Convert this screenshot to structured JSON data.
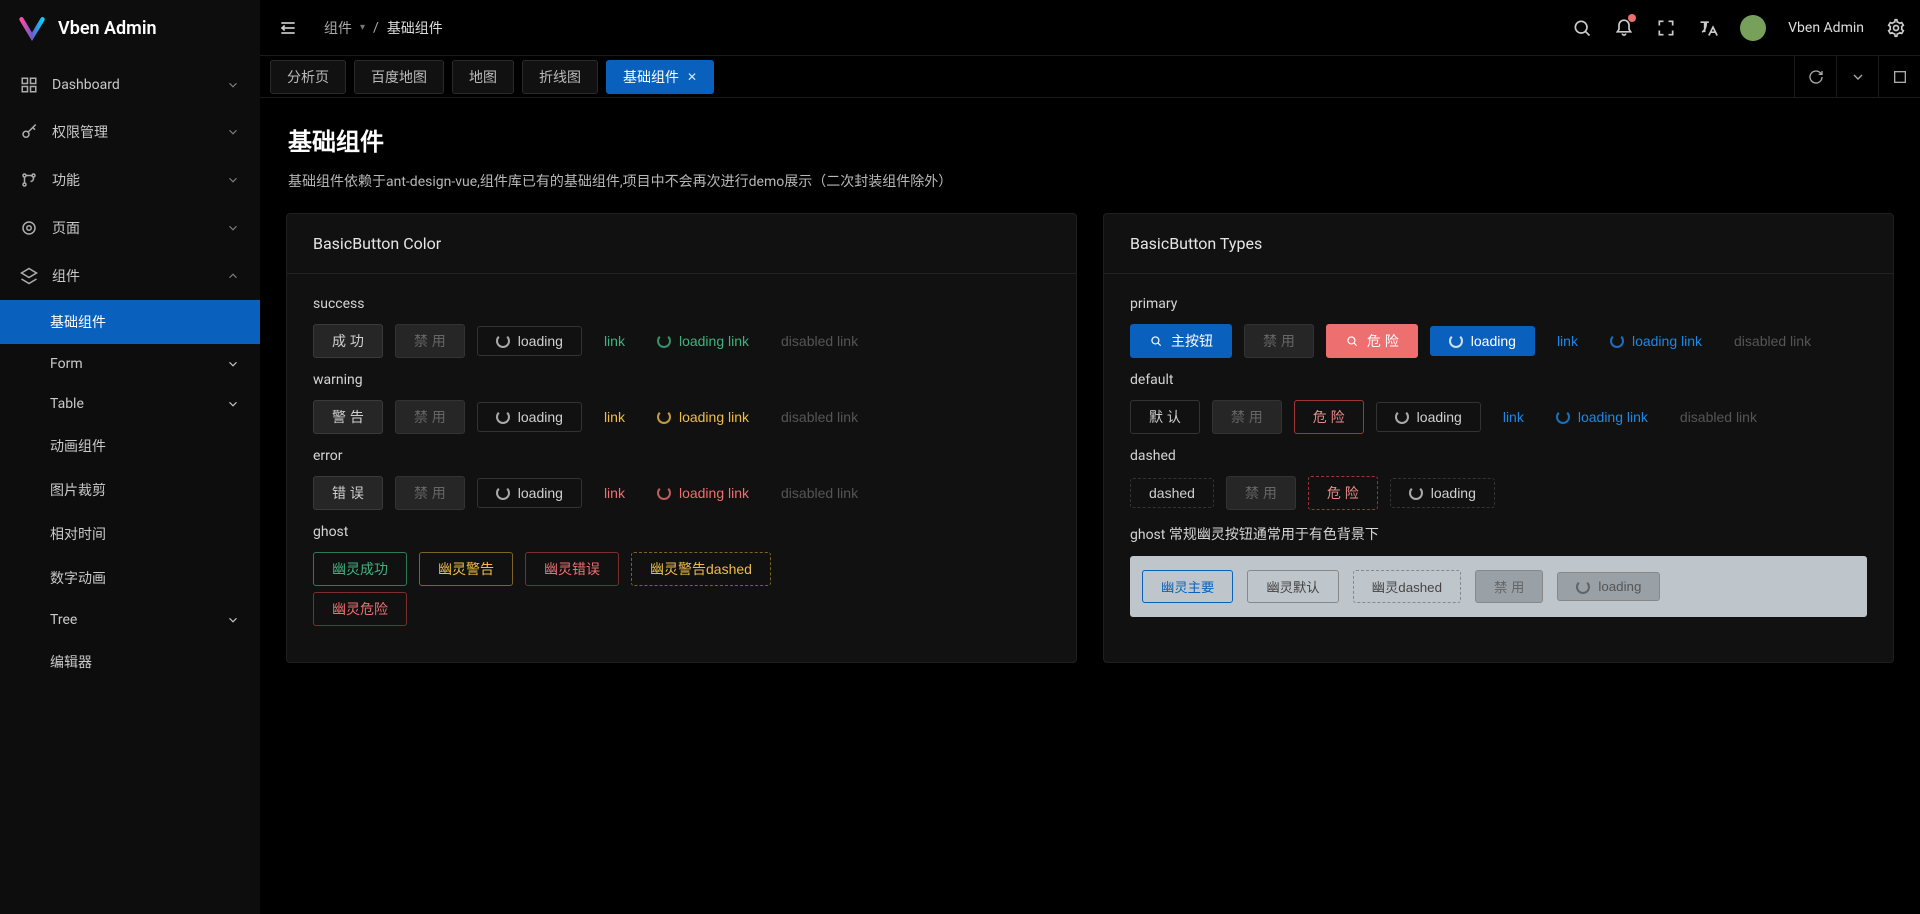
{
  "brand": {
    "name": "Vben Admin"
  },
  "user": {
    "name": "Vben Admin"
  },
  "sidebar": {
    "items": [
      {
        "label": "Dashboard",
        "icon": "grid"
      },
      {
        "label": "权限管理",
        "icon": "key"
      },
      {
        "label": "功能",
        "icon": "branch"
      },
      {
        "label": "页面",
        "icon": "target"
      },
      {
        "label": "组件",
        "icon": "stack",
        "open": true,
        "children": [
          {
            "label": "基础组件",
            "active": true
          },
          {
            "label": "Form",
            "expandable": true
          },
          {
            "label": "Table",
            "expandable": true
          },
          {
            "label": "动画组件"
          },
          {
            "label": "图片裁剪"
          },
          {
            "label": "相对时间"
          },
          {
            "label": "数字动画"
          },
          {
            "label": "Tree",
            "expandable": true
          },
          {
            "label": "编辑器"
          }
        ]
      }
    ]
  },
  "breadcrumb": {
    "parent": "组件",
    "current": "基础组件",
    "sep": "/"
  },
  "tabs": {
    "items": [
      {
        "label": "分析页"
      },
      {
        "label": "百度地图"
      },
      {
        "label": "地图"
      },
      {
        "label": "折线图"
      },
      {
        "label": "基础组件",
        "active": true,
        "closable": true
      }
    ]
  },
  "page": {
    "title": "基础组件",
    "desc": "基础组件依赖于ant-design-vue,组件库已有的基础组件,项目中不会再次进行demo展示（二次封装组件除外）"
  },
  "card_color": {
    "title": "BasicButton Color",
    "sections": {
      "success": {
        "label": "success",
        "btn": "成 功",
        "disabled": "禁 用",
        "loading": "loading",
        "link": "link",
        "loading_link": "loading link",
        "disabled_link": "disabled link"
      },
      "warning": {
        "label": "warning",
        "btn": "警 告",
        "disabled": "禁 用",
        "loading": "loading",
        "link": "link",
        "loading_link": "loading link",
        "disabled_link": "disabled link"
      },
      "error": {
        "label": "error",
        "btn": "错 误",
        "disabled": "禁 用",
        "loading": "loading",
        "link": "link",
        "loading_link": "loading link",
        "disabled_link": "disabled link"
      },
      "ghost": {
        "label": "ghost",
        "g_success": "幽灵成功",
        "g_warning": "幽灵警告",
        "g_error": "幽灵错误",
        "g_warning_dashed": "幽灵警告dashed",
        "g_danger": "幽灵危险"
      }
    }
  },
  "card_types": {
    "title": "BasicButton Types",
    "primary": {
      "label": "primary",
      "main": "主按钮",
      "disabled": "禁 用",
      "danger": "危 险",
      "loading": "loading",
      "link": "link",
      "loading_link": "loading link",
      "disabled_link": "disabled link"
    },
    "default": {
      "label": "default",
      "main": "默 认",
      "disabled": "禁 用",
      "danger": "危 险",
      "loading": "loading",
      "link": "link",
      "loading_link": "loading link",
      "disabled_link": "disabled link"
    },
    "dashed": {
      "label": "dashed",
      "main": "dashed",
      "disabled": "禁 用",
      "danger": "危 险",
      "loading": "loading"
    },
    "ghost": {
      "label": "ghost 常规幽灵按钮通常用于有色背景下",
      "primary": "幽灵主要",
      "default": "幽灵默认",
      "dashed": "幽灵dashed",
      "disabled": "禁 用",
      "loading": "loading"
    }
  }
}
